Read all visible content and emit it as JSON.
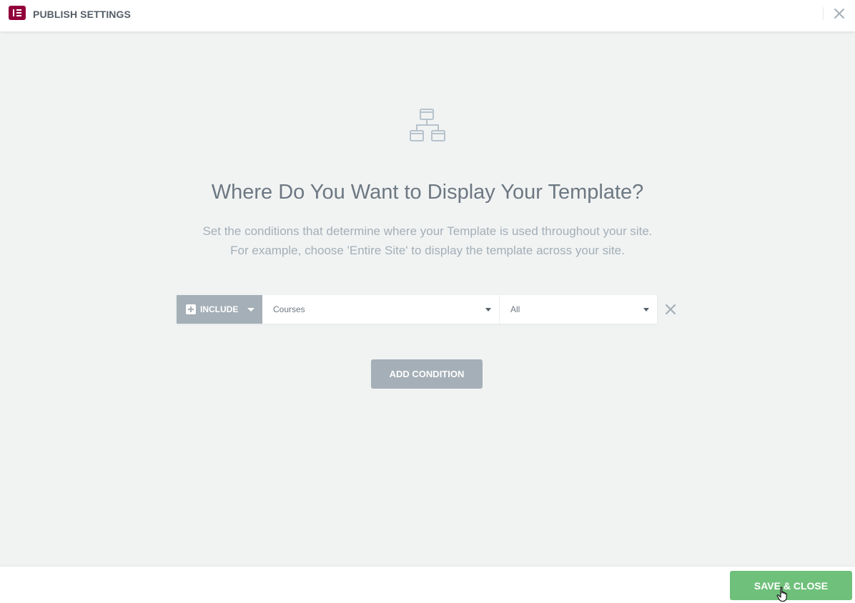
{
  "header": {
    "title": "PUBLISH SETTINGS",
    "logo_icon": "elementor-logo-icon",
    "close_icon": "close-icon",
    "brand_color": "#92003b"
  },
  "main": {
    "icon": "site-hierarchy-icon",
    "title": "Where Do You Want to Display Your Template?",
    "description_line1": "Set the conditions that determine where your Template is used throughout your site.",
    "description_line2": "For example, choose 'Entire Site' to display the template across your site."
  },
  "condition": {
    "type_label": "INCLUDE",
    "type_icon": "plus-square-icon",
    "main_select_value": "Courses",
    "sub_select_value": "All",
    "remove_icon": "close-icon"
  },
  "actions": {
    "add_condition_label": "ADD CONDITION",
    "save_close_label": "SAVE & CLOSE",
    "save_color": "#6fc07a",
    "neutral_color": "#a4afb7"
  }
}
